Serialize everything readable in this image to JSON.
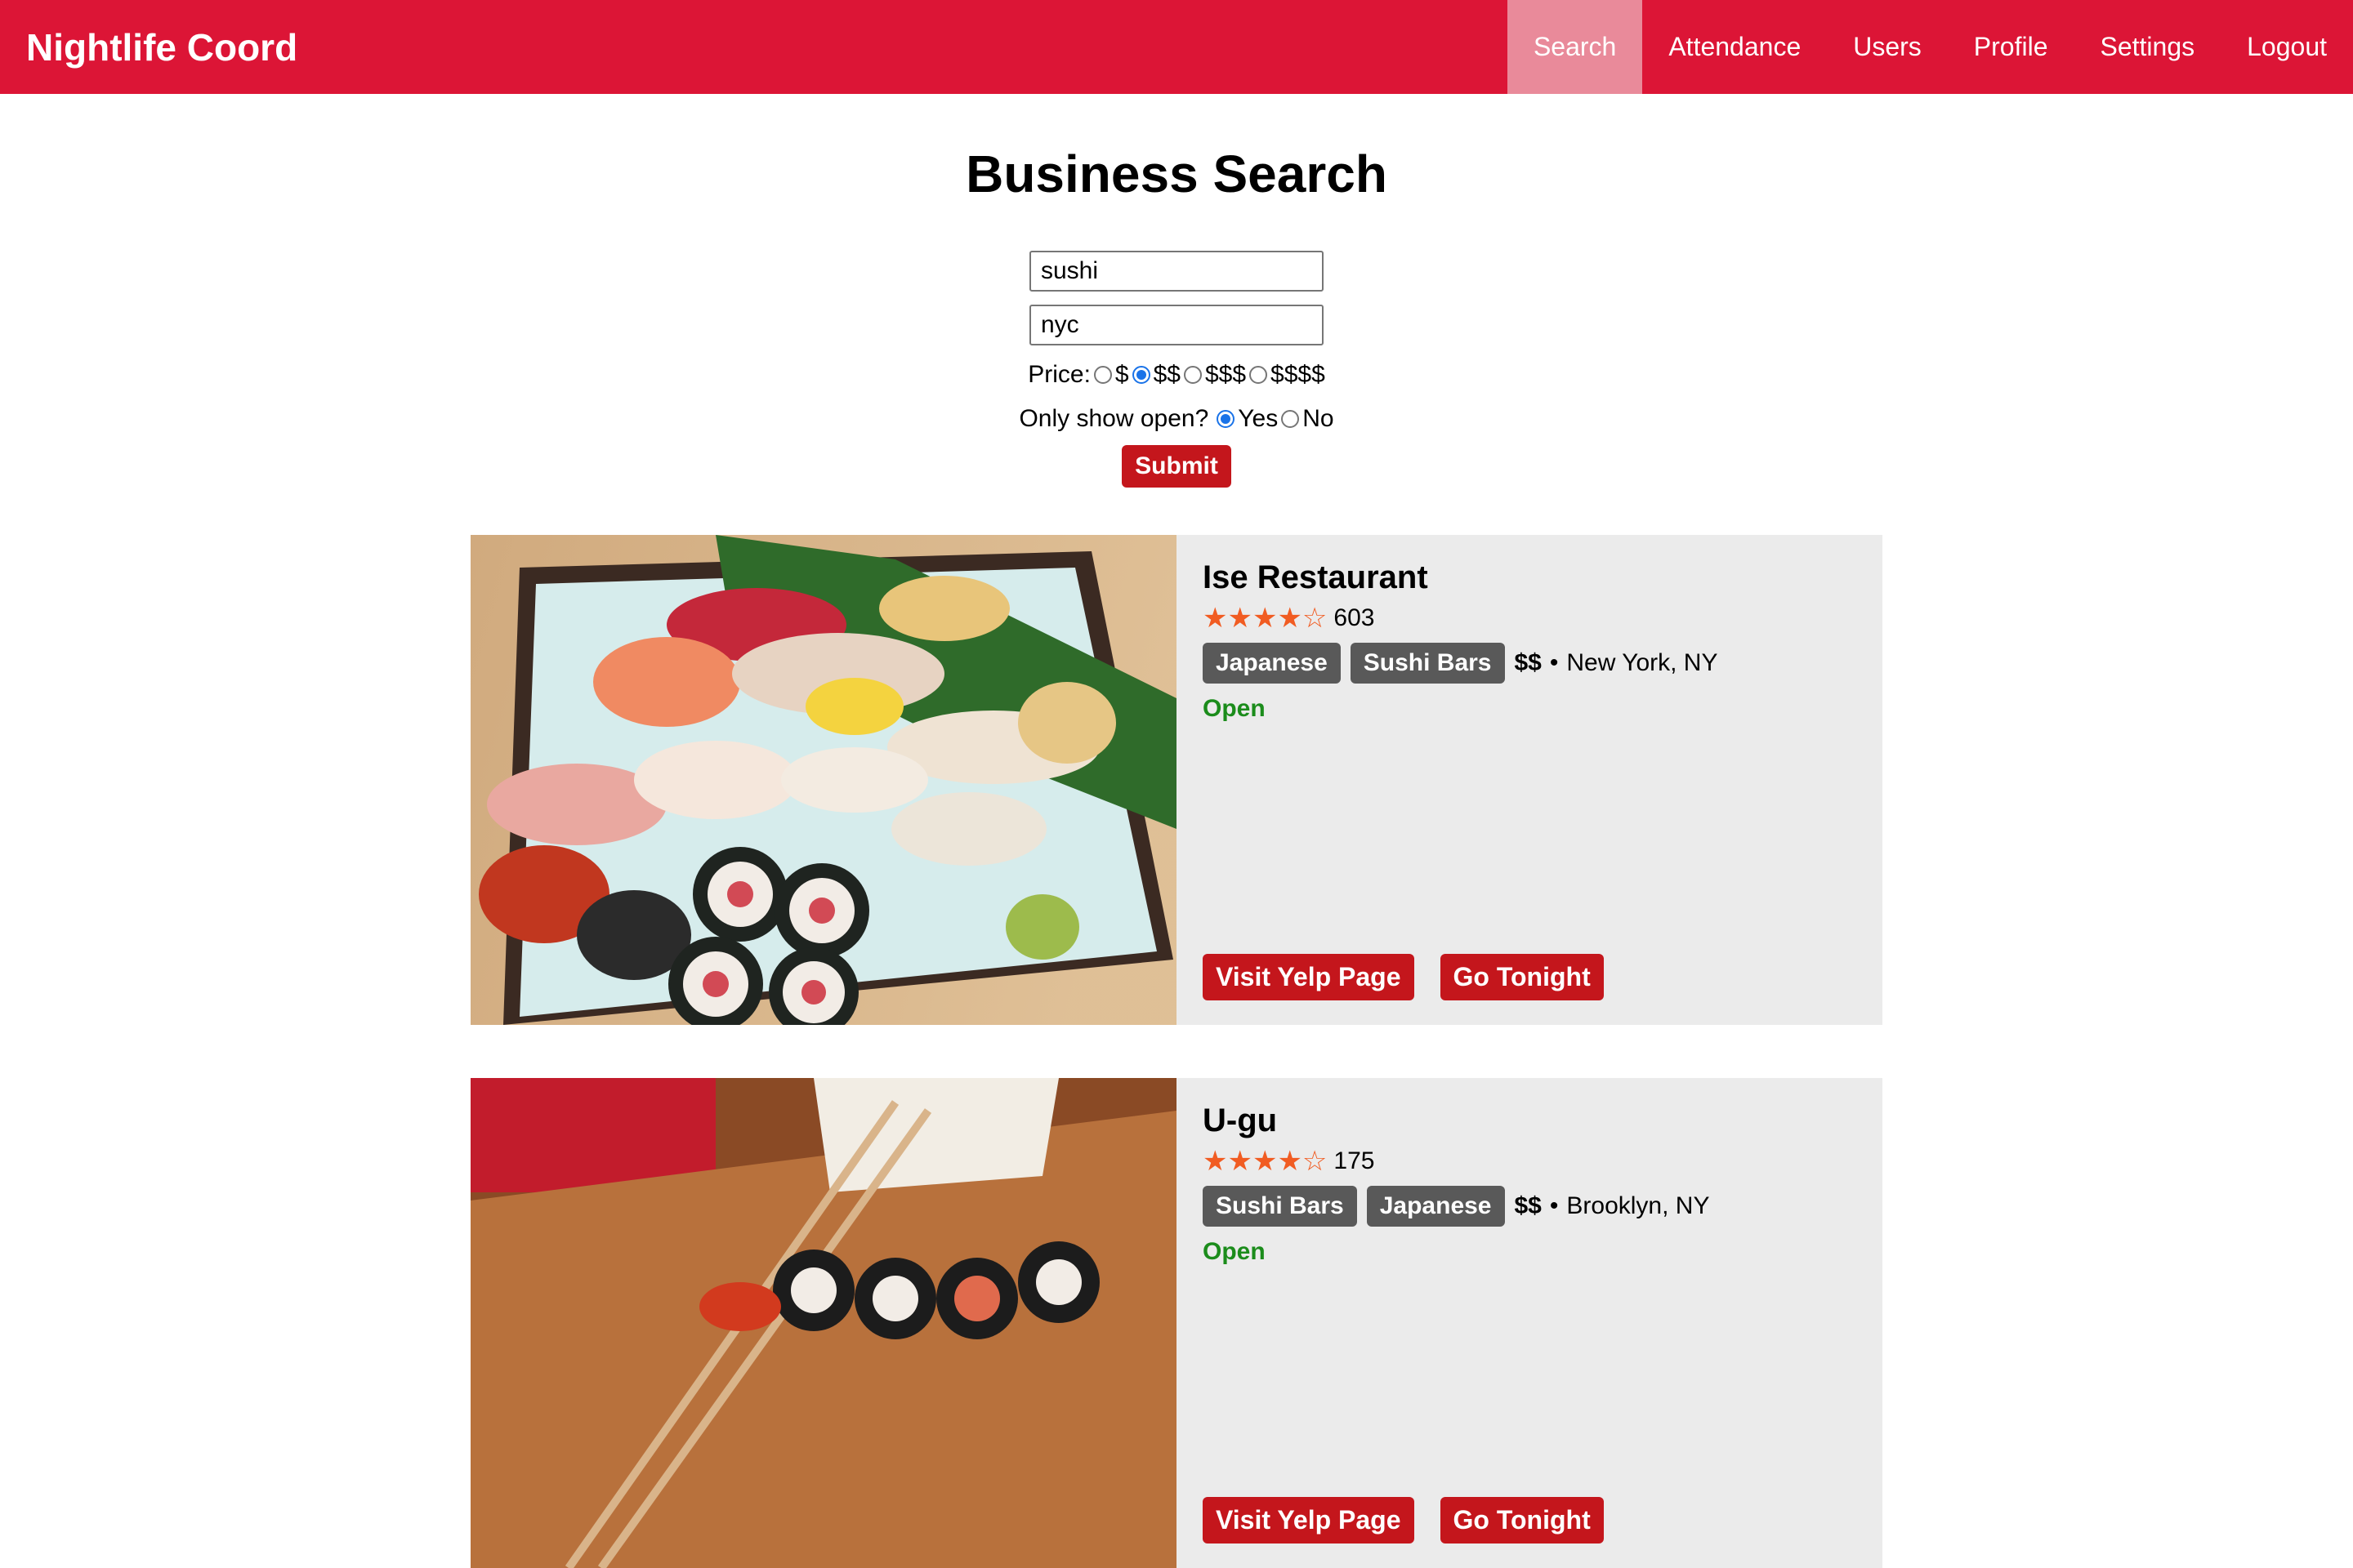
{
  "navbar": {
    "brand": "Nightlife Coord",
    "items": [
      {
        "label": "Search",
        "active": true
      },
      {
        "label": "Attendance"
      },
      {
        "label": "Users"
      },
      {
        "label": "Profile"
      },
      {
        "label": "Settings"
      },
      {
        "label": "Logout"
      }
    ]
  },
  "search": {
    "title": "Business Search",
    "term_value": "sushi",
    "location_value": "nyc",
    "price_label": "Price:",
    "price_options": [
      "$",
      "$$",
      "$$$",
      "$$$$"
    ],
    "price_selected": "$$",
    "open_label": "Only show open?",
    "open_options": [
      "Yes",
      "No"
    ],
    "open_selected": "Yes",
    "submit_label": "Submit"
  },
  "results": [
    {
      "name": "Ise Restaurant",
      "rating": 4.5,
      "stars": "★★★★☆",
      "review_count": "603",
      "categories": [
        "Japanese",
        "Sushi Bars"
      ],
      "price": "$$",
      "separator": "•",
      "location": "New York, NY",
      "status": "Open",
      "visit_label": "Visit Yelp Page",
      "go_label": "Go Tonight"
    },
    {
      "name": "U-gu",
      "rating": 4.5,
      "stars": "★★★★☆",
      "review_count": "175",
      "categories": [
        "Sushi Bars",
        "Japanese"
      ],
      "price": "$$",
      "separator": "•",
      "location": "Brooklyn, NY",
      "status": "Open",
      "visit_label": "Visit Yelp Page",
      "go_label": "Go Tonight"
    }
  ],
  "colors": {
    "navbar": "#dc1536",
    "nav_active": "#e98a9a",
    "button": "#c4161c",
    "tag": "#595959",
    "star": "#f15c22",
    "open": "#1b8c1b",
    "card": "#ebebeb"
  },
  "icons": {
    "star": "star-icon",
    "radio": "radio-icon"
  }
}
